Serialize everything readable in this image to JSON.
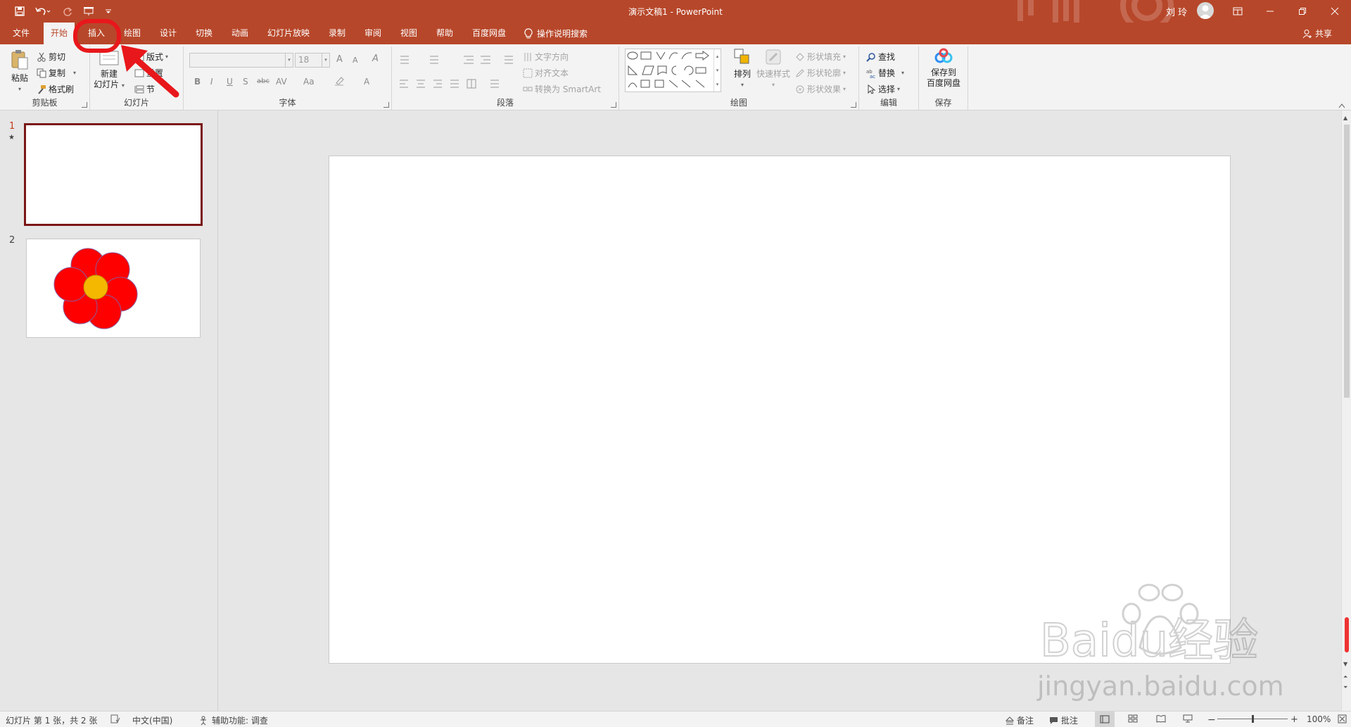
{
  "titlebar": {
    "doc_title": "演示文稿1  -  PowerPoint",
    "user_name": "刘 玲",
    "accent": "#b7472a"
  },
  "tabs": [
    "文件",
    "开始",
    "插入",
    "绘图",
    "设计",
    "切换",
    "动画",
    "幻灯片放映",
    "录制",
    "审阅",
    "视图",
    "帮助",
    "百度网盘"
  ],
  "active_tab": "开始",
  "tell_me": "操作说明搜索",
  "share": "共享",
  "ribbon": {
    "clipboard": {
      "paste": "粘贴",
      "cut": "剪切",
      "copy": "复制",
      "painter": "格式刷",
      "label": "剪贴板"
    },
    "slides": {
      "new_slide_1": "新建",
      "new_slide_2": "幻灯片",
      "layout": "版式",
      "reset": "重置",
      "section": "节",
      "label": "幻灯片"
    },
    "font": {
      "size": "18",
      "bold": "B",
      "italic": "I",
      "underline": "U",
      "shadow": "S",
      "strike": "abc",
      "spacing": "AV",
      "case": "Aa",
      "grow": "A",
      "shrink": "A",
      "clear": "A",
      "color": "A",
      "label": "字体"
    },
    "paragraph": {
      "text_direction": "文字方向",
      "align_text": "对齐文本",
      "smartart": "转换为 SmartArt",
      "label": "段落"
    },
    "drawing": {
      "arrange": "排列",
      "quick_styles": "快速样式",
      "fill": "形状填充",
      "outline": "形状轮廓",
      "effects": "形状效果",
      "label": "绘图"
    },
    "editing": {
      "find": "查找",
      "replace": "替换",
      "select": "选择",
      "label": "编辑"
    },
    "save": {
      "line1": "保存到",
      "line2": "百度网盘",
      "label": "保存"
    }
  },
  "slides": [
    {
      "number": "1",
      "star": "★",
      "selected": true
    },
    {
      "number": "2",
      "selected": false
    }
  ],
  "status": {
    "slide_info": "幻灯片 第 1 张，共 2 张",
    "language": "中文(中国)",
    "accessibility": "辅助功能: 调查",
    "notes": "备注",
    "comments": "批注",
    "zoom": "100%"
  },
  "watermark": {
    "brand": "Baidu经验",
    "url": "jingyan.baidu.com"
  },
  "colors": {
    "selection_border": "#7b1616",
    "petal": "#ff0000",
    "center": "#f5b800",
    "annotation": "#e8171b"
  }
}
